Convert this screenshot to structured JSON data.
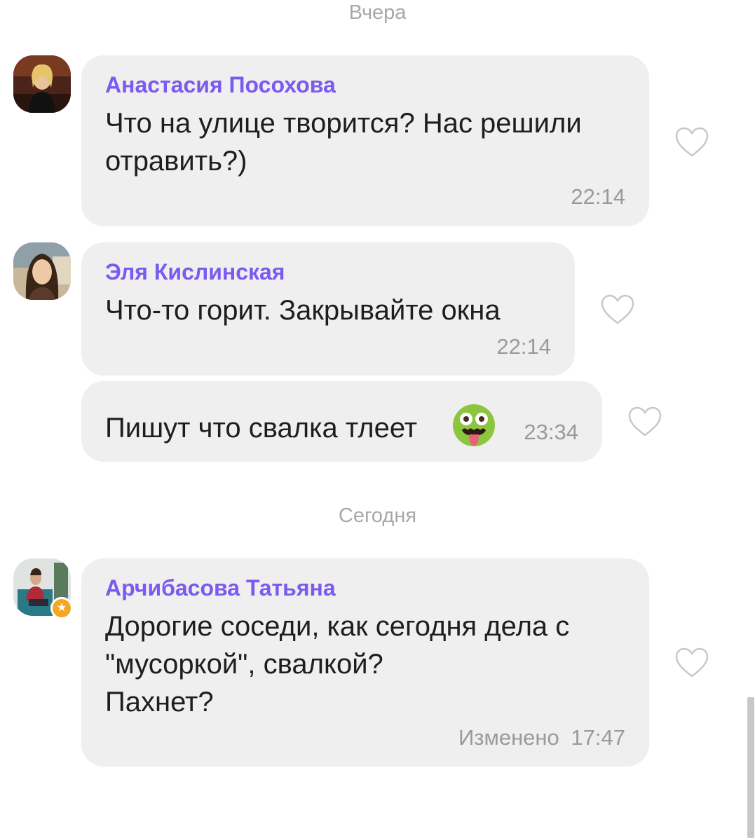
{
  "separators": {
    "yesterday": "Вчера",
    "today": "Сегодня"
  },
  "messages": [
    {
      "sender": "Анастасия Посохова",
      "lines": [
        "Что на улице творится? Нас решили",
        "отравить?)"
      ],
      "time": "22:14",
      "liked": false
    },
    {
      "sender": "Эля Кислинская",
      "lines": [
        "Что-то горит. Закрывайте окна"
      ],
      "time": "22:14",
      "liked": false
    },
    {
      "sender": "",
      "lines": [
        "Пишут что свалка тлеет"
      ],
      "emoji": "nauseated-face",
      "time": "23:34",
      "liked": false
    },
    {
      "sender": "Арчибасова Татьяна",
      "lines": [
        "Дорогие соседи, как сегодня дела с",
        "\"мусоркой\", свалкой?",
        "Пахнет?"
      ],
      "edited_label": "Изменено",
      "time": "17:47",
      "liked": false,
      "badge": "star-badge"
    }
  ],
  "colors": {
    "sender_name": "#7a5af0",
    "bubble_bg": "#efefef",
    "timestamp": "#9a9a9a",
    "separator": "#a8a8a8",
    "badge": "#f5a623"
  }
}
